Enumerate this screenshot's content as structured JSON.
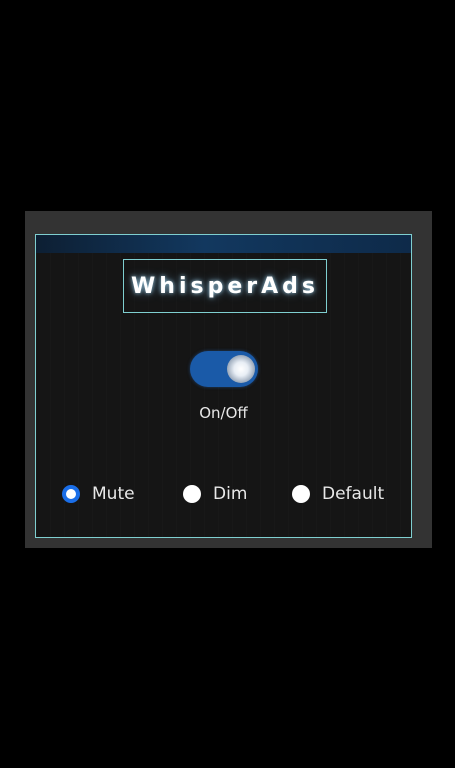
{
  "brand": {
    "title": "WhisperAds"
  },
  "power_toggle": {
    "label": "On/Off",
    "state": "on",
    "accent_color": "#1a5aa8"
  },
  "mode": {
    "options": [
      {
        "label": "Mute",
        "checked": true
      },
      {
        "label": "Dim",
        "checked": false
      },
      {
        "label": "Default",
        "checked": false
      }
    ],
    "selected": "Mute",
    "radio_accent": "#1a6ee8"
  },
  "colors": {
    "border": "#7fcfd0",
    "panel_bg": "#151515",
    "frame_bg": "#333333",
    "page_bg": "#000000"
  }
}
